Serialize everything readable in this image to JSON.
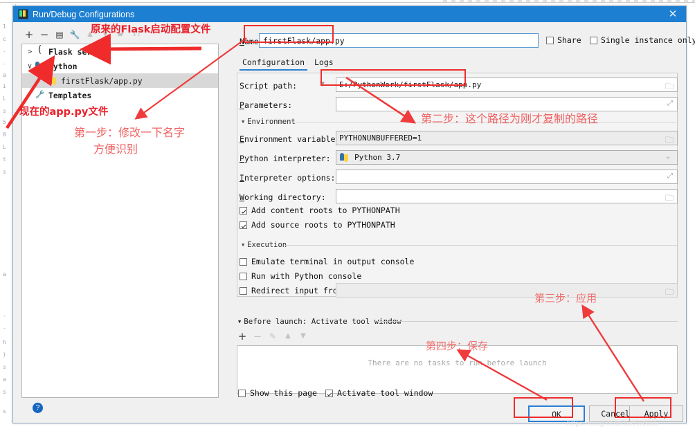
{
  "window": {
    "title": "Run/Debug Configurations",
    "close_label": "✕",
    "app_icon": "pycharm-icon"
  },
  "left_panel": {
    "toolbar": [
      {
        "name": "add-button",
        "glyph": "+",
        "enabled": true
      },
      {
        "name": "remove-button",
        "glyph": "−",
        "enabled": true
      },
      {
        "name": "copy-button",
        "glyph": "❐",
        "enabled": true
      },
      {
        "name": "edit-templates-button",
        "glyph": "ὒ7",
        "enabled": true
      },
      {
        "name": "move-up-button",
        "glyph": "▲",
        "enabled": false
      },
      {
        "name": "move-down-button",
        "glyph": "▼",
        "enabled": false
      },
      {
        "name": "new-folder-button",
        "glyph": "⧉",
        "enabled": false
      },
      {
        "name": "sort-button",
        "glyph": "↓",
        "enabled": false
      }
    ],
    "tree": [
      {
        "label": "Flask server",
        "twisty": ">",
        "icon": "flask-icon",
        "indent": 0,
        "bold": true,
        "selected": false
      },
      {
        "label": "Python",
        "twisty": "∨",
        "icon": "python-icon",
        "indent": 0,
        "bold": true,
        "selected": false
      },
      {
        "label": "firstFlask/app.py",
        "twisty": "",
        "icon": "python-icon",
        "indent": 1,
        "bold": false,
        "selected": true
      },
      {
        "label": "Templates",
        "twisty": "",
        "icon": "wrench-icon",
        "indent": 0,
        "bold": true,
        "selected": false
      }
    ],
    "help_label": "?"
  },
  "header": {
    "name_label": "Name:",
    "name_value": "firstFlask/app.py",
    "share_label": "Share",
    "share_checked": false,
    "single_instance_label": "Single instance only",
    "single_instance_checked": false
  },
  "tabs": [
    {
      "label": "Configuration",
      "active": true
    },
    {
      "label": "Logs",
      "active": false
    }
  ],
  "configuration": {
    "script_path_label": "Script path:",
    "script_path_value": "E:/PythonWork/firstFlask/app.py",
    "parameters_label": "Parameters:",
    "parameters_value": "",
    "environment_section": "Environment",
    "environment_variables_label": "Environment variables:",
    "environment_variables_value": "PYTHONUNBUFFERED=1",
    "python_interpreter_label": "Python interpreter:",
    "python_interpreter_value": "Python 3.7",
    "interpreter_options_label": "Interpreter options:",
    "interpreter_options_value": "",
    "working_directory_label": "Working directory:",
    "working_directory_value": "",
    "add_content_roots_label": "Add content roots to PYTHONPATH",
    "add_content_roots_checked": true,
    "add_source_roots_label": "Add source roots to PYTHONPATH",
    "add_source_roots_checked": true,
    "execution_section": "Execution",
    "emulate_terminal_label": "Emulate terminal in output console",
    "emulate_terminal_checked": false,
    "run_with_console_label": "Run with Python console",
    "run_with_console_checked": false,
    "redirect_input_label": "Redirect input from:",
    "redirect_input_checked": false,
    "redirect_input_value": ""
  },
  "before_launch": {
    "header": "Before launch: Activate tool window",
    "toolbar": [
      {
        "name": "add-task-button",
        "glyph": "+",
        "enabled": true
      },
      {
        "name": "remove-task-button",
        "glyph": "−",
        "enabled": false
      },
      {
        "name": "edit-task-button",
        "glyph": "✎",
        "enabled": false
      },
      {
        "name": "move-task-up-button",
        "glyph": "▲",
        "enabled": false
      },
      {
        "name": "move-task-down-button",
        "glyph": "▼",
        "enabled": false
      }
    ],
    "empty_text": "There are no tasks to run before launch",
    "show_page_label": "Show this page",
    "show_page_checked": false,
    "activate_tool_window_label": "Activate tool window",
    "activate_tool_window_checked": true
  },
  "footer": {
    "ok_label": "OK",
    "cancel_label": "Cancel",
    "apply_label": "Apply",
    "watermark": "https://blog.csdn.net/ws665"
  },
  "annotations": [
    {
      "id": "ann-flask-config",
      "text": "原来的Flask启动配置文件",
      "style": "bold"
    },
    {
      "id": "ann-current-app",
      "text": "现在的app.py文件",
      "style": "bold"
    },
    {
      "id": "ann-step1-line1",
      "text": "第一步：修改一下名字",
      "style": "serif"
    },
    {
      "id": "ann-step1-line2",
      "text": "方便识别",
      "style": "serif"
    },
    {
      "id": "ann-step2",
      "text": "第二步：这个路径为刚才复制的路径",
      "style": "serif"
    },
    {
      "id": "ann-step3",
      "text": "第三步：应用",
      "style": "serif"
    },
    {
      "id": "ann-step4",
      "text": "第四步：保存",
      "style": "serif"
    }
  ],
  "colors": {
    "titlebar": "#1d7fd1",
    "accent": "#2a7fd4",
    "annotation_red": "#f04040",
    "annotation_bold_red": "#e8202a"
  },
  "background_code_lines": [
    "1",
    "c",
    "-",
    "-",
    "a",
    "i",
    "L",
    "s",
    "5",
    "0",
    "L",
    "t",
    "s",
    "a",
    "-",
    "-",
    "h",
    ")",
    "s",
    "a",
    "s",
    "s"
  ]
}
